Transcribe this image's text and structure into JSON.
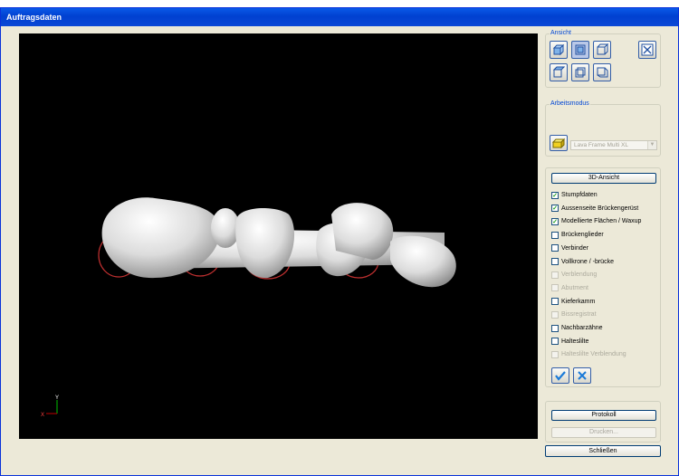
{
  "window": {
    "title": "Auftragsdaten"
  },
  "view_panel": {
    "legend": "Ansicht",
    "buttons": [
      "view-iso-icon",
      "view-front-icon",
      "view-side-icon",
      "fit-view-icon",
      "view-top-icon",
      "view-back-icon",
      "view-bottom-icon"
    ]
  },
  "work_mode": {
    "legend": "Arbeitsmodus",
    "material_selected": "Lava Frame Multi XL"
  },
  "layers": {
    "view_3d_label": "3D-Ansicht",
    "items": [
      {
        "label": "Stumpfdaten",
        "checked": true,
        "enabled": true
      },
      {
        "label": "Aussenseite Brückengerüst",
        "checked": true,
        "enabled": true
      },
      {
        "label": "Modellierte Flächen / Waxup",
        "checked": true,
        "enabled": true
      },
      {
        "label": "Brückenglieder",
        "checked": false,
        "enabled": true
      },
      {
        "label": "Verbinder",
        "checked": false,
        "enabled": true
      },
      {
        "label": "Vollkrone / -brücke",
        "checked": false,
        "enabled": true
      },
      {
        "label": "Verblendung",
        "checked": false,
        "enabled": false
      },
      {
        "label": "Abutment",
        "checked": false,
        "enabled": false
      },
      {
        "label": "Kieferkamm",
        "checked": false,
        "enabled": true
      },
      {
        "label": "Bissregistrat",
        "checked": false,
        "enabled": false
      },
      {
        "label": "Nachbarzähne",
        "checked": false,
        "enabled": true
      },
      {
        "label": "Halteslilte",
        "checked": false,
        "enabled": true
      },
      {
        "label": "Halteslilte Verblendung",
        "checked": false,
        "enabled": false
      }
    ],
    "confirm_icon": "check-icon",
    "cancel_icon": "x-icon"
  },
  "report": {
    "protokoll_label": "Protokoll",
    "print_label": "Drucken..."
  },
  "close_label": "Schließen",
  "axes": {
    "y": "Y",
    "x": "X"
  },
  "colors": {
    "titlebar": "#0a5ae8",
    "viewport": "#000000",
    "tooth": "#e6e6e6"
  }
}
